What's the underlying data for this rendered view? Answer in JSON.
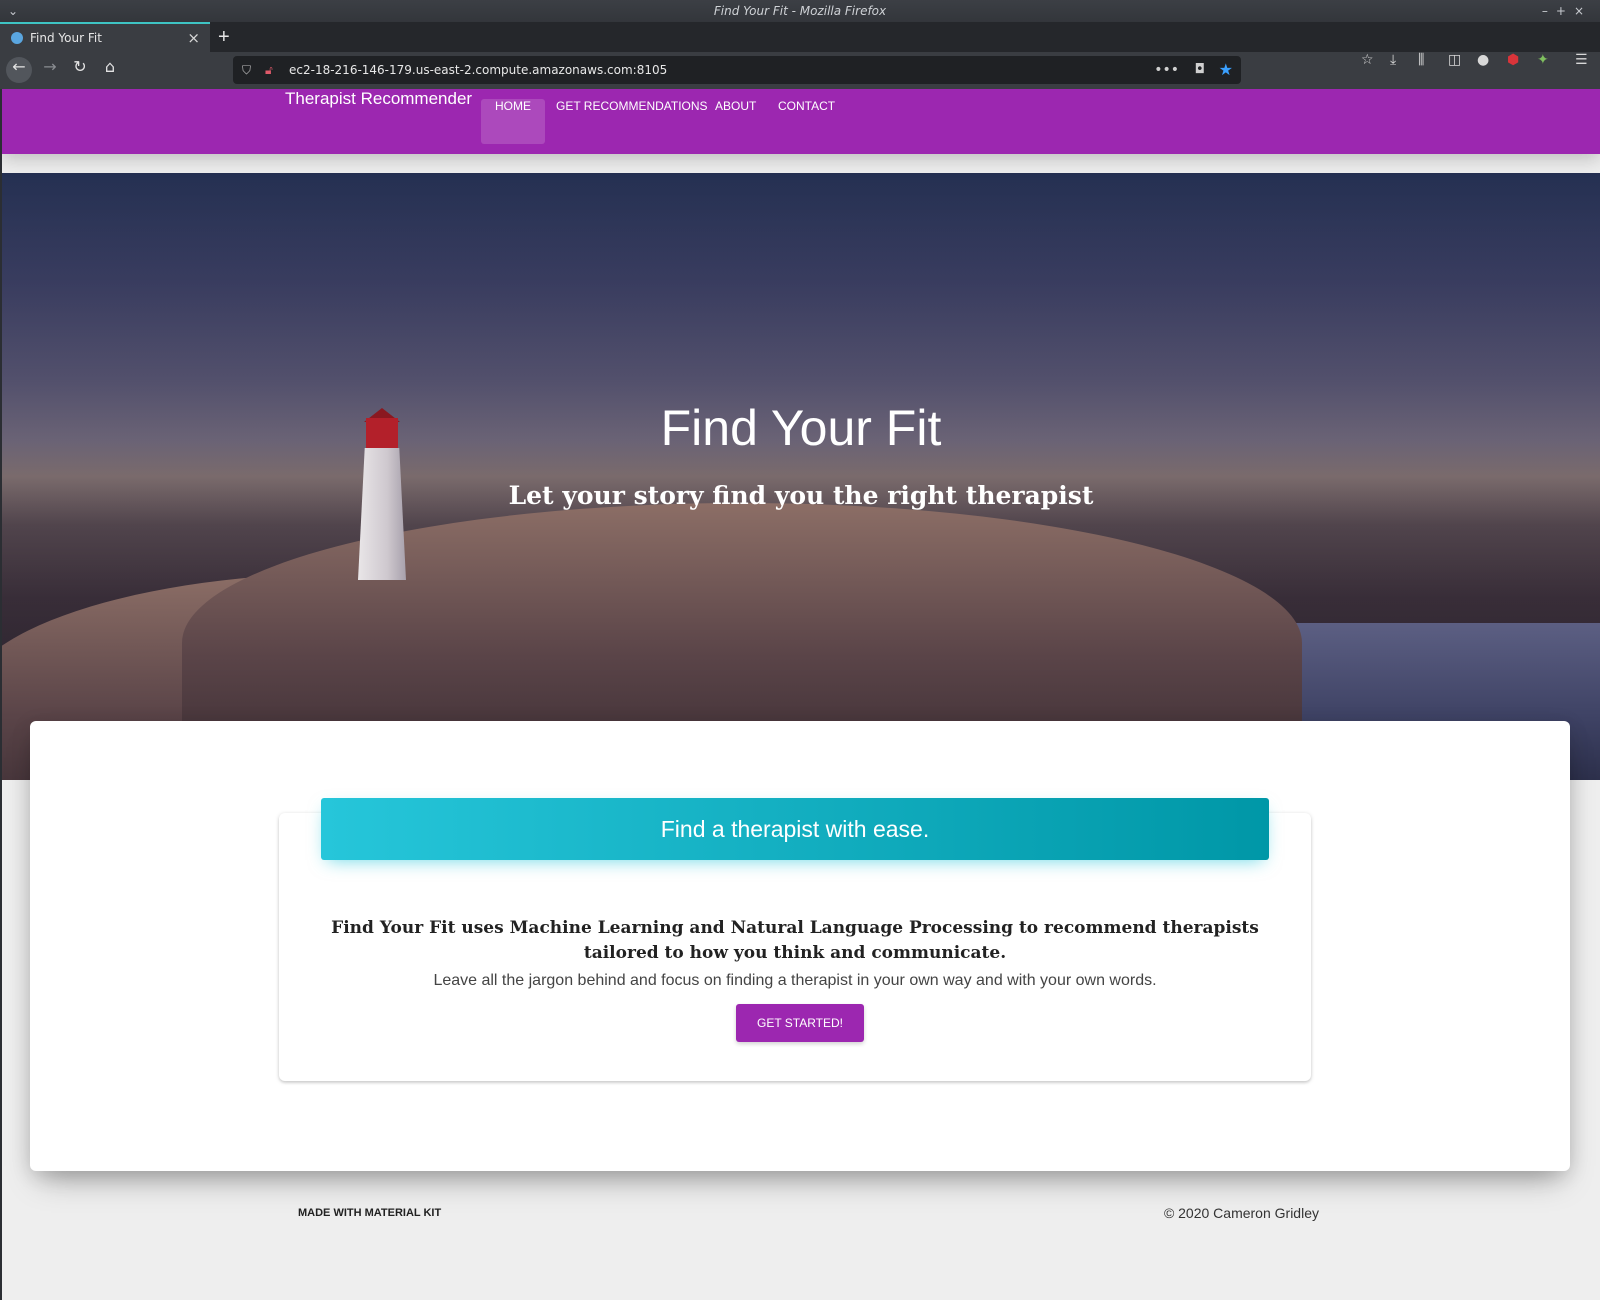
{
  "browser": {
    "window_title": "Find Your Fit - Mozilla Firefox",
    "tab_title": "Find Your Fit",
    "url": "ec2-18-216-146-179.us-east-2.compute.amazonaws.com:8105",
    "icons": [
      "back-icon",
      "forward-icon",
      "reload-icon",
      "home-icon",
      "shield-icon",
      "insecure-lock-icon",
      "more-icon",
      "pocket-icon",
      "bookmark-star-icon",
      "downloads-icon",
      "library-icon",
      "sidebar-icon",
      "account-icon",
      "ublock-icon",
      "extension-icon",
      "menu-icon"
    ]
  },
  "nav": {
    "brand": "Therapist Recommender",
    "links": [
      "Home",
      "Get Recommendations",
      "About",
      "Contact"
    ],
    "active": "Home",
    "color": "#9c27b0"
  },
  "hero": {
    "title": "Find Your Fit",
    "subtitle": "Let your story find you the right therapist"
  },
  "card": {
    "header": "Find a therapist with ease.",
    "header_colors": [
      "#26c6da",
      "#0097a7"
    ],
    "description_bold": "Find Your Fit uses Machine Learning and Natural Language Processing to recommend therapists tailored to how you think and communicate.",
    "description": "Leave all the jargon behind and focus on finding a therapist in your own way and with your own words.",
    "cta": "Get Started!"
  },
  "footer": {
    "left": "Made with Material Kit",
    "right": "© 2020 Cameron Gridley"
  }
}
